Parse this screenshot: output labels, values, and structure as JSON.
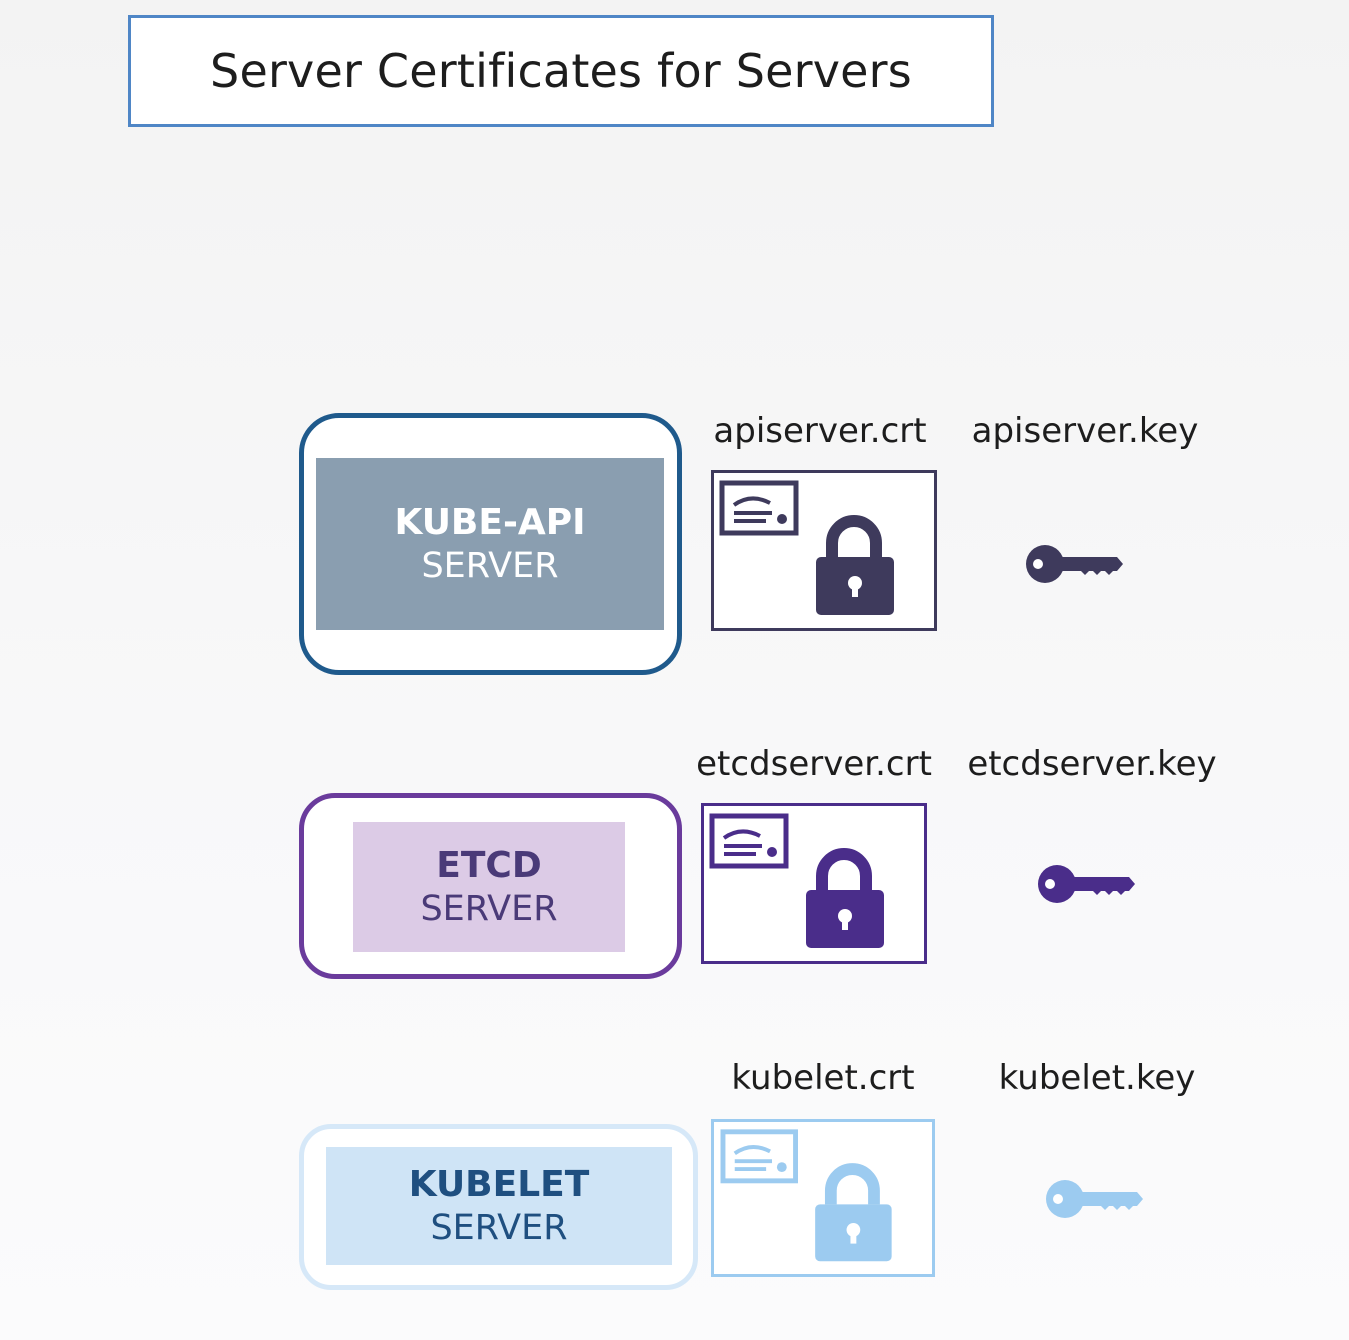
{
  "title": "Server Certificates for Servers",
  "servers": [
    {
      "name": "KUBE-API",
      "subtitle": "SERVER",
      "cert_file": "apiserver.crt",
      "key_file": "apiserver.key",
      "frame_color": "#1f5a8c",
      "fill_color": "#8a9eb0",
      "text_color": "#ffffff",
      "icon_color": "#3e3a5c"
    },
    {
      "name": "ETCD",
      "subtitle": "SERVER",
      "cert_file": "etcdserver.crt",
      "key_file": "etcdserver.key",
      "frame_color": "#6a3b9c",
      "fill_color": "#dccbe6",
      "text_color": "#4a3a78",
      "icon_color": "#4a2d8a"
    },
    {
      "name": "KUBELET",
      "subtitle": "SERVER",
      "cert_file": "kubelet.crt",
      "key_file": "kubelet.key",
      "frame_color": "#d6e8f8",
      "fill_color": "#cfe4f6",
      "text_color": "#1f4f80",
      "icon_color": "#9ccbf0"
    }
  ],
  "icons": [
    "certificate-icon",
    "padlock-icon",
    "key-icon"
  ]
}
